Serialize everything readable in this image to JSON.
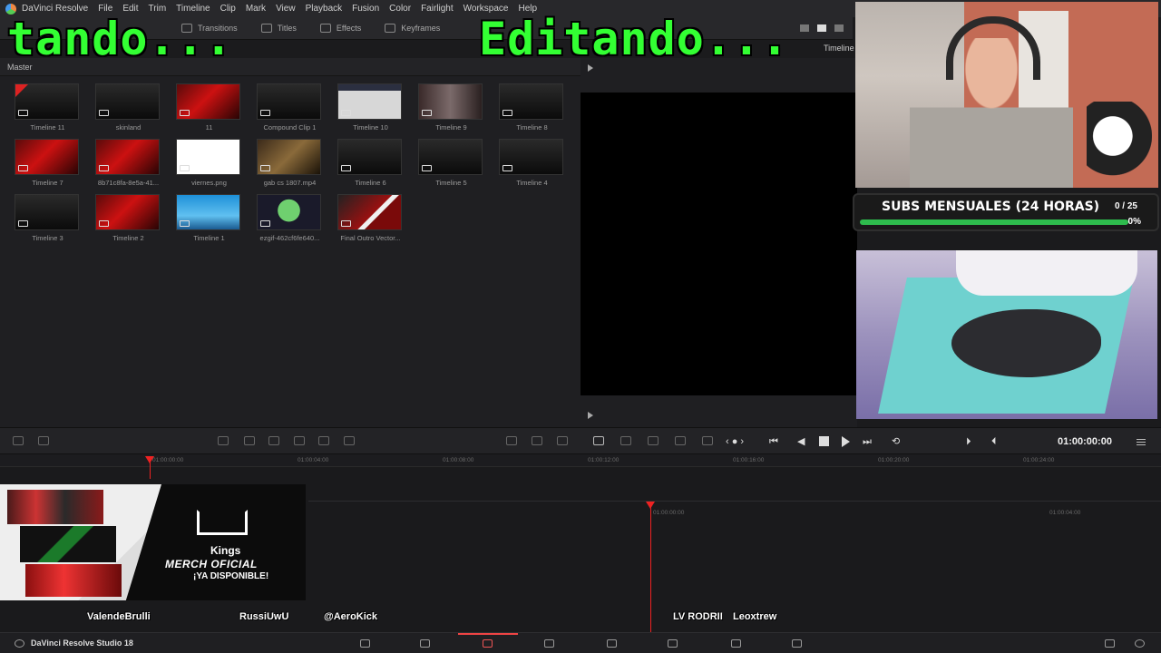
{
  "menu": [
    "DaVinci Resolve",
    "File",
    "Edit",
    "Trim",
    "Timeline",
    "Clip",
    "Mark",
    "View",
    "Playback",
    "Fusion",
    "Color",
    "Fairlight",
    "Workspace",
    "Help"
  ],
  "toolbar": {
    "transitions": "Transitions",
    "titles": "Titles",
    "effects": "Effects",
    "keyframes": "Keyframes"
  },
  "pool": {
    "title": "Master",
    "clips": [
      {
        "label": "Timeline 11",
        "thumb": "dark",
        "flag": true
      },
      {
        "label": "skinland",
        "thumb": "dark"
      },
      {
        "label": "11",
        "thumb": "red"
      },
      {
        "label": "Compound Clip 1",
        "thumb": "dark"
      },
      {
        "label": "Timeline 10",
        "thumb": "screen"
      },
      {
        "label": "Timeline 9",
        "thumb": "room"
      },
      {
        "label": "Timeline 8",
        "thumb": "dark"
      },
      {
        "label": "Timeline 7",
        "thumb": "red"
      },
      {
        "label": "8b71c8fa-8e5a-41...",
        "thumb": "red"
      },
      {
        "label": "viernes.png",
        "thumb": "cal"
      },
      {
        "label": "gab cs 1807.mp4",
        "thumb": "game"
      },
      {
        "label": "Timeline 6",
        "thumb": "dark"
      },
      {
        "label": "Timeline 5",
        "thumb": "dark"
      },
      {
        "label": "Timeline 4",
        "thumb": "dark"
      },
      {
        "label": "Timeline 3",
        "thumb": "dark"
      },
      {
        "label": "Timeline 2",
        "thumb": "red"
      },
      {
        "label": "Timeline 1",
        "thumb": "desk"
      },
      {
        "label": "ezgif-462cf6fe640...",
        "thumb": "mascot"
      },
      {
        "label": "Final Outro Vector...",
        "thumb": "vector"
      }
    ]
  },
  "viewer": {
    "label": "Timeline",
    "timecode": "01:00:00:00"
  },
  "ruler": [
    "01:00:00:00",
    "01:00:04:00",
    "01:00:08:00",
    "01:00:12:00",
    "01:00:16:00",
    "01:00:20:00",
    "01:00:24:00"
  ],
  "ruler2": [
    "01:00:00:00",
    "01:00:04:00"
  ],
  "overlay": {
    "edit_left": "tando...",
    "edit_right": "Editando...",
    "subs_title": "SUBS MENSUALES (24 HORAS)",
    "subs_count": "0 / 25",
    "subs_pct": "0%",
    "subs_progress": 0,
    "merch_brand": "Kings",
    "merch_line1": "MERCH OFICIAL",
    "merch_line2": "¡YA DISPONIBLE!",
    "names": [
      "ValendeBrulli",
      "RussiUwU",
      "@AeroKick",
      "LV RODRII",
      "Leoxtrew"
    ]
  },
  "pagebar": {
    "brand": "DaVinci Resolve Studio 18"
  },
  "colors": {
    "accent": "#e22222",
    "overlay_green": "#33ff33",
    "progress_green": "#2ebc4d"
  }
}
